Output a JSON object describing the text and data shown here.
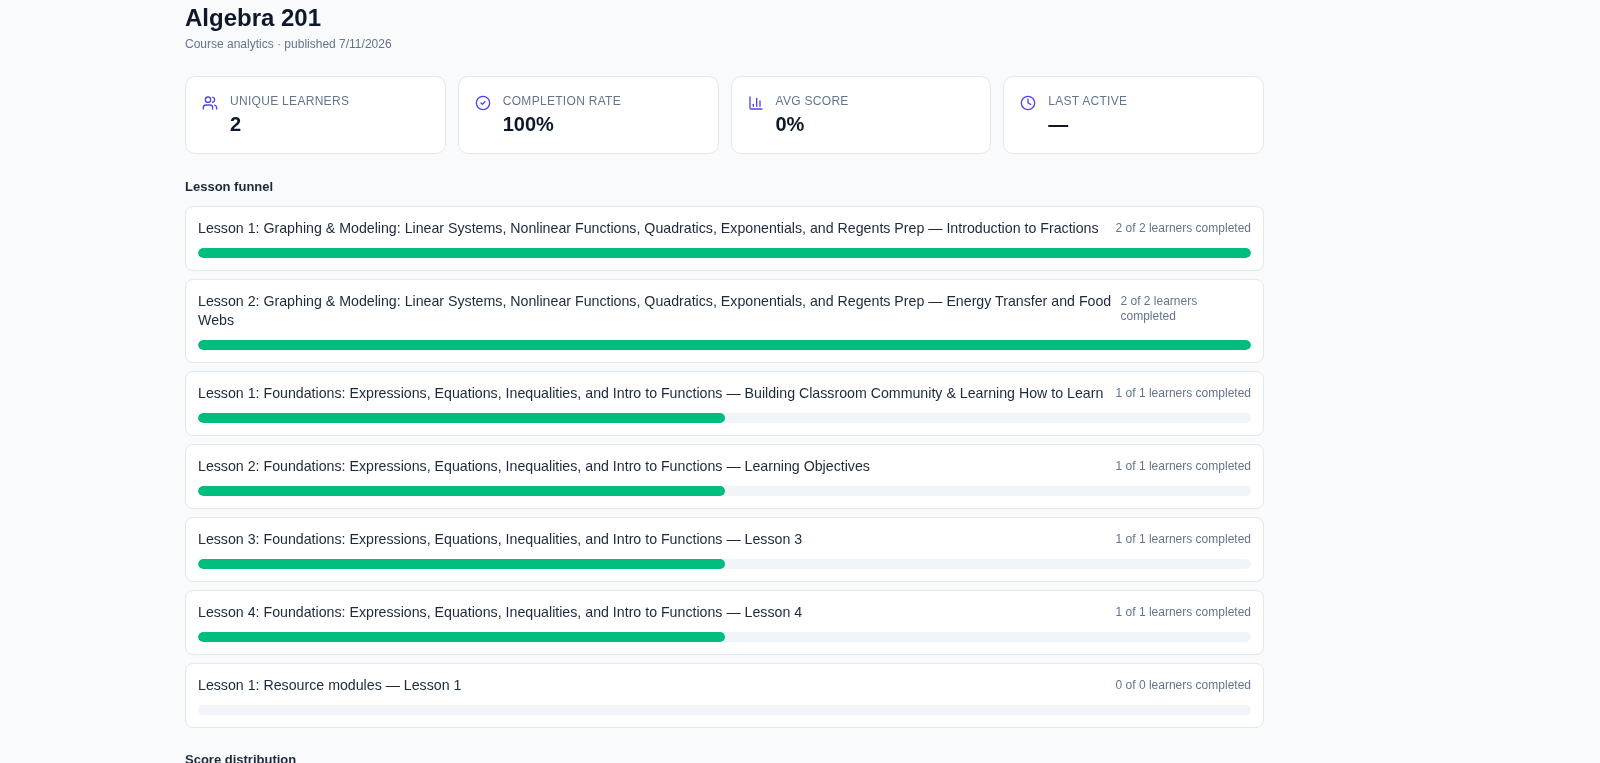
{
  "page": {
    "title": "Algebra 201",
    "subtitle": "Course analytics · published 7/11/2026"
  },
  "stats": [
    {
      "kind": "learners",
      "label": "UNIQUE LEARNERS",
      "value": "2"
    },
    {
      "kind": "completion",
      "label": "COMPLETION RATE",
      "value": "100%"
    },
    {
      "kind": "score",
      "label": "AVG SCORE",
      "value": "0%"
    },
    {
      "kind": "activity",
      "label": "LAST ACTIVE",
      "value": "—"
    }
  ],
  "lesson_funnel": {
    "title": "Lesson funnel",
    "lessons": [
      {
        "title": "Lesson 1: Graphing & Modeling: Linear Systems, Nonlinear Functions, Quadratics, Exponentials, and Regents Prep — Introduction to Fractions",
        "completed": "2 of 2 learners completed",
        "level": 1
      },
      {
        "title": "Lesson 2: Graphing & Modeling: Linear Systems, Nonlinear Functions, Quadratics, Exponentials, and Regents Prep — Energy Transfer and Food Webs",
        "completed": "2 of 2 learners completed",
        "level": 1
      },
      {
        "title": "Lesson 1: Foundations: Expressions, Equations, Inequalities, and Intro to Functions — Building Classroom Community & Learning How to Learn",
        "completed": "1 of 1 learners completed",
        "level": 0.5
      },
      {
        "title": "Lesson 2: Foundations: Expressions, Equations, Inequalities, and Intro to Functions — Learning Objectives",
        "completed": "1 of 1 learners completed",
        "level": 0.5
      },
      {
        "title": "Lesson 3: Foundations: Expressions, Equations, Inequalities, and Intro to Functions — Lesson 3",
        "completed": "1 of 1 learners completed",
        "level": 0.5
      },
      {
        "title": "Lesson 4: Foundations: Expressions, Equations, Inequalities, and Intro to Functions — Lesson 4",
        "completed": "1 of 1 learners completed",
        "level": 0.5
      },
      {
        "title": "Lesson 1: Resource modules — Lesson 1",
        "completed": "0 of 0 learners completed"
      }
    ]
  },
  "score_distribution": {
    "title": "Score distribution"
  }
}
